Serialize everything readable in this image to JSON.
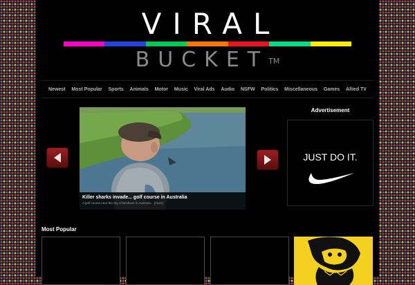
{
  "logo": {
    "top": "VIRAL",
    "bottom": "BUCKET",
    "tm": "TM"
  },
  "colors": {
    "bar": [
      "#ff00c8",
      "#2244dd",
      "#00cc55",
      "#ff7700",
      "#ee1122",
      "#00dd88",
      "#ffee00"
    ],
    "arrow": "#8b1a1c",
    "poster": "#f4d020"
  },
  "nav": [
    "Newest",
    "Most Popular",
    "Sports",
    "Animals",
    "Motor",
    "Music",
    "Viral Ads",
    "Audio",
    "NSFW",
    "Politics",
    "Miscellaneous",
    "Games",
    "Allied TV"
  ],
  "featured": {
    "title": "Killer sharks invade... golf course in Australia",
    "subtitle": "A golf course near the city of Brisbane in Australia... [more]"
  },
  "ad": {
    "label": "Advertisement",
    "text": "JUST DO IT."
  },
  "most_popular": {
    "title": "Most Popular"
  },
  "icons": {
    "prev": "arrow-left-icon",
    "next": "arrow-right-icon",
    "ad_logo": "swoosh-icon"
  }
}
